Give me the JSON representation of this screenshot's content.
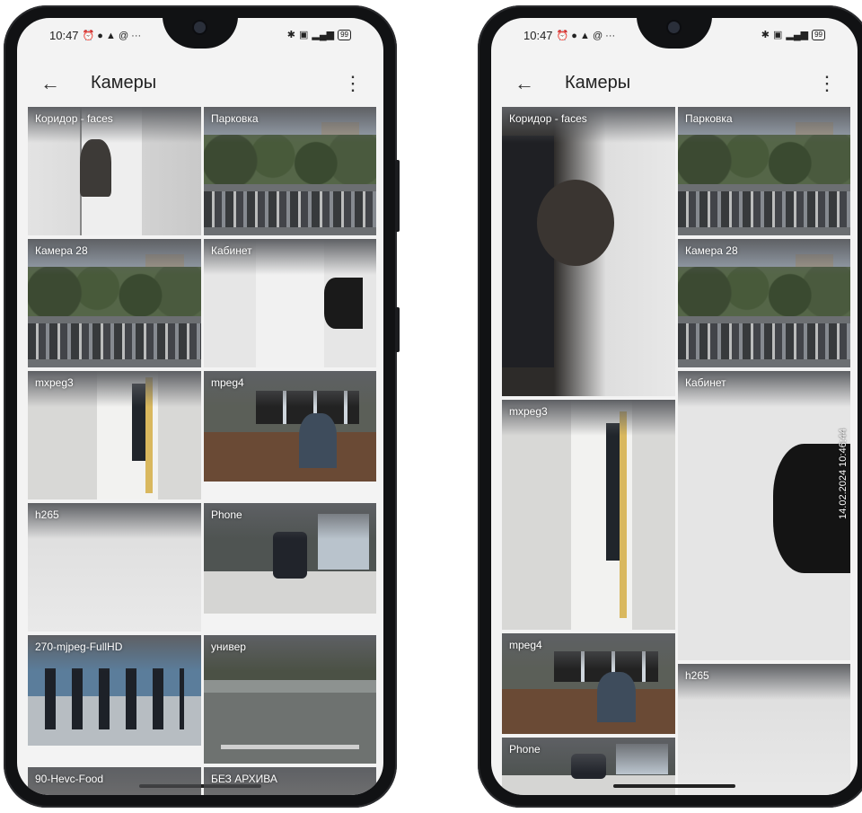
{
  "status_bar": {
    "time": "10:47",
    "left_icons": "⏰ ● ▲ @ ···",
    "battery": "99"
  },
  "toolbar": {
    "back_icon": "←",
    "title": "Камеры",
    "menu_icon": "⋮"
  },
  "left_phone": {
    "tiles": [
      "Коридор - faces",
      "Парковка",
      "Камера 28",
      "Кабинет",
      "mxpeg3",
      "mpeg4",
      "h265",
      "Phone",
      "270-mjpeg-FullHD",
      "универ",
      "90-Hevc-Food",
      "БЕЗ АРХИВА"
    ]
  },
  "right_phone": {
    "tiles": [
      "Коридор - faces",
      "Парковка",
      "Камера 28",
      "mxpeg3",
      "Кабинет",
      "mpeg4",
      "h265",
      "Phone"
    ],
    "timestamp": "14.02.2024 10:46:44"
  },
  "colors": {
    "screen_bg": "#f3f3f3",
    "frame": "#111214",
    "label": "#ffffff"
  }
}
